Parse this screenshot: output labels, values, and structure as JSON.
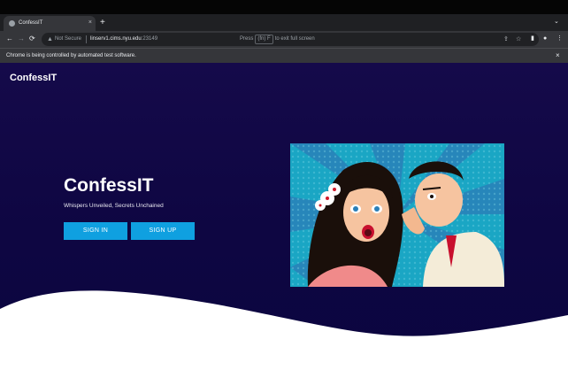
{
  "browser": {
    "tab_title": "ConfessIT",
    "tab_close": "×",
    "new_tab": "+",
    "tab_menu": "⌄",
    "nav": {
      "back": "←",
      "forward": "→",
      "reload": "⟳"
    },
    "security_label": "Not Secure",
    "url_host": "linserv1.cims.nyu.edu",
    "url_port": ":23149",
    "fullscreen_prefix": "Press",
    "fullscreen_key": "(fn) F",
    "fullscreen_suffix": "to exit full screen",
    "automation_notice": "Chrome is being controlled by automated test software.",
    "infobar_close": "×"
  },
  "page": {
    "brand": "ConfessIT",
    "hero": {
      "title": "ConfessIT",
      "subtitle": "Whispers Unveiled, Secrets Unchained",
      "sign_in": "SIGN IN",
      "sign_up": "SIGN UP"
    }
  },
  "colors": {
    "page_bg": "#0e0642",
    "button": "#0fa0e0",
    "wave": "#ffffff"
  }
}
